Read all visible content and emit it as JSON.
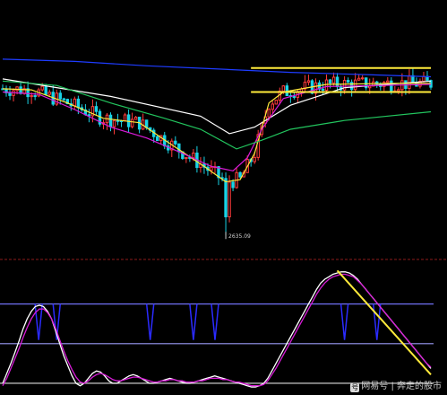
{
  "chart_data": [
    {
      "type": "candlestick",
      "panel": "price",
      "grid": false,
      "ylim": [
        2550,
        3530
      ],
      "x_count": 120,
      "annotations": [
        {
          "text": "2635.09",
          "x": 62,
          "y": 2635.09
        }
      ],
      "candles": [],
      "moving_averages": [
        {
          "color": "#ffffff",
          "points": [
            [
              0,
              3350
            ],
            [
              30,
              3270
            ],
            [
              55,
              3180
            ],
            [
              63,
              3100
            ],
            [
              70,
              3130
            ],
            [
              80,
              3230
            ],
            [
              95,
              3310
            ],
            [
              119,
              3340
            ]
          ]
        },
        {
          "color": "#ffeb3b",
          "points": [
            [
              0,
              3305
            ],
            [
              8,
              3300
            ],
            [
              18,
              3240
            ],
            [
              28,
              3170
            ],
            [
              38,
              3150
            ],
            [
              46,
              3060
            ],
            [
              56,
              2950
            ],
            [
              62,
              2880
            ],
            [
              66,
              2890
            ],
            [
              70,
              3010
            ],
            [
              74,
              3240
            ],
            [
              78,
              3290
            ],
            [
              90,
              3325
            ],
            [
              110,
              3330
            ],
            [
              119,
              3330
            ]
          ]
        },
        {
          "color": "#d81bd8",
          "points": [
            [
              0,
              3290
            ],
            [
              10,
              3280
            ],
            [
              20,
              3210
            ],
            [
              30,
              3130
            ],
            [
              40,
              3080
            ],
            [
              50,
              3010
            ],
            [
              58,
              2950
            ],
            [
              64,
              2930
            ],
            [
              68,
              2990
            ],
            [
              72,
              3120
            ],
            [
              78,
              3260
            ],
            [
              90,
              3315
            ],
            [
              119,
              3325
            ]
          ]
        },
        {
          "color": "#22c55e",
          "points": [
            [
              0,
              3340
            ],
            [
              15,
              3320
            ],
            [
              30,
              3240
            ],
            [
              45,
              3170
            ],
            [
              55,
              3120
            ],
            [
              65,
              3030
            ],
            [
              72,
              3070
            ],
            [
              80,
              3120
            ],
            [
              95,
              3160
            ],
            [
              119,
              3200
            ]
          ]
        },
        {
          "color": "#1e3cff",
          "points": [
            [
              0,
              3440
            ],
            [
              20,
              3430
            ],
            [
              40,
              3410
            ],
            [
              60,
              3395
            ],
            [
              80,
              3380
            ],
            [
              100,
              3370
            ],
            [
              119,
              3360
            ]
          ]
        }
      ],
      "horizontal_lines": [
        {
          "color": "#ffeb3b",
          "y": 3400,
          "x_start": 69,
          "x_end": 119
        },
        {
          "color": "#ffeb3b",
          "y": 3290,
          "x_start": 69,
          "x_end": 119
        }
      ]
    },
    {
      "type": "line",
      "panel": "indicator",
      "grid": false,
      "ylim": [
        0,
        100
      ],
      "series": [
        {
          "color": "#ffffff",
          "values": [
            8,
            16,
            24,
            33,
            42,
            52,
            60,
            66,
            70,
            71,
            70,
            66,
            60,
            50,
            40,
            30,
            22,
            14,
            8,
            6,
            8,
            12,
            16,
            18,
            17,
            14,
            10,
            8,
            8,
            10,
            12,
            14,
            15,
            14,
            12,
            10,
            8,
            8,
            9,
            10,
            11,
            12,
            11,
            10,
            9,
            8,
            8,
            9,
            10,
            11,
            12,
            13,
            14,
            13,
            12,
            11,
            10,
            9,
            8,
            7,
            6,
            5,
            5,
            6,
            8,
            12,
            18,
            24,
            30,
            36,
            42,
            48,
            54,
            60,
            66,
            72,
            78,
            84,
            89,
            92,
            94,
            96,
            97,
            98,
            98,
            97,
            95,
            92,
            88,
            84,
            80,
            76,
            72,
            68,
            64,
            60,
            56,
            52,
            48,
            44,
            40,
            36,
            32,
            28,
            24,
            20
          ]
        },
        {
          "color": "#d81bd8",
          "values": [
            6,
            12,
            20,
            28,
            36,
            45,
            53,
            60,
            65,
            68,
            68,
            65,
            60,
            52,
            43,
            34,
            26,
            19,
            13,
            9,
            8,
            10,
            13,
            15,
            16,
            15,
            13,
            11,
            10,
            10,
            11,
            12,
            13,
            13,
            12,
            11,
            10,
            9,
            9,
            10,
            10,
            11,
            11,
            10,
            10,
            9,
            9,
            9,
            10,
            10,
            11,
            12,
            12,
            12,
            11,
            11,
            10,
            9,
            9,
            8,
            7,
            6,
            6,
            6,
            7,
            10,
            15,
            20,
            26,
            32,
            38,
            44,
            50,
            56,
            62,
            68,
            74,
            80,
            85,
            89,
            92,
            94,
            95,
            96,
            96,
            95,
            94,
            91,
            88,
            84,
            80,
            76,
            72,
            68,
            64,
            60,
            56,
            52,
            48,
            44,
            40,
            36,
            32,
            28,
            24,
            21
          ]
        }
      ],
      "horizontal_lines": [
        {
          "color": "#6e6ef0",
          "y": 72
        },
        {
          "color": "#9a9af5",
          "y": 40
        },
        {
          "color": "#e0e0e0",
          "y": 8
        }
      ],
      "spikes": [
        {
          "color": "#2b2bff",
          "x": 10
        },
        {
          "color": "#2b2bff",
          "x": 15
        },
        {
          "color": "#2b2bff",
          "x": 41
        },
        {
          "color": "#2b2bff",
          "x": 53
        },
        {
          "color": "#2b2bff",
          "x": 59
        },
        {
          "color": "#2b2bff",
          "x": 95
        },
        {
          "color": "#2b2bff",
          "x": 104
        }
      ],
      "trend_line": {
        "color": "#ffeb3b",
        "from": [
          93,
          99
        ],
        "to": [
          119,
          15
        ]
      }
    }
  ],
  "watermark": {
    "logo": "号",
    "text": "网易号 | 奔走的股市"
  }
}
